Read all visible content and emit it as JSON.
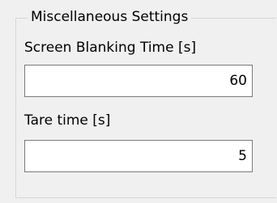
{
  "group": {
    "title": "Miscellaneous Settings"
  },
  "fields": {
    "screen_blanking": {
      "label": "Screen Blanking Time [s]",
      "value": "60"
    },
    "tare_time": {
      "label": "Tare time [s]",
      "value": "5"
    }
  }
}
